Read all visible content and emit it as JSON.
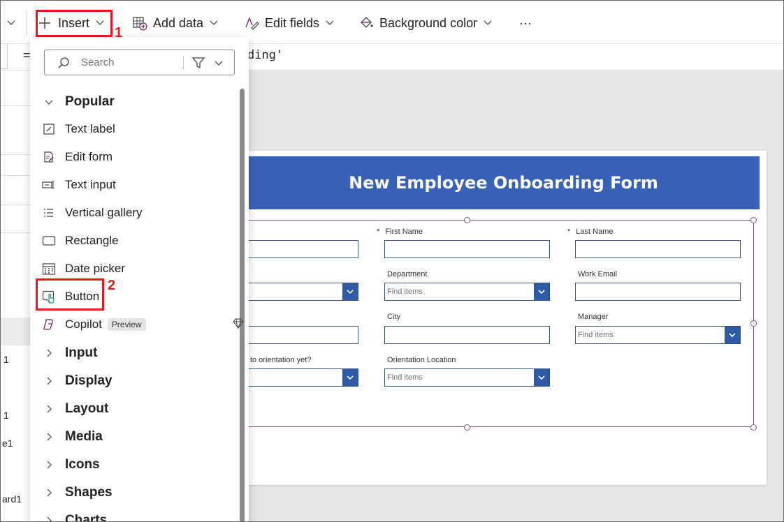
{
  "toolbar": {
    "insert_label": "Insert",
    "add_data_label": "Add data",
    "edit_fields_label": "Edit fields",
    "background_color_label": "Background color",
    "more_label": "···"
  },
  "callouts": {
    "step1": "1",
    "step2": "2"
  },
  "formula": {
    "equals": "=",
    "text": "ding'"
  },
  "tree": {
    "item_a": "1",
    "item_b": "1",
    "item_c": "e1",
    "item_d": "ard1"
  },
  "insert_panel": {
    "search_placeholder": "Search",
    "popular_label": "Popular",
    "items": [
      {
        "label": "Text label",
        "icon": "text-label-icon"
      },
      {
        "label": "Edit form",
        "icon": "edit-form-icon"
      },
      {
        "label": "Text input",
        "icon": "text-input-icon"
      },
      {
        "label": "Vertical gallery",
        "icon": "vertical-gallery-icon"
      },
      {
        "label": "Rectangle",
        "icon": "rectangle-icon"
      },
      {
        "label": "Date picker",
        "icon": "date-picker-icon"
      },
      {
        "label": "Button",
        "icon": "button-icon"
      },
      {
        "label": "Copilot",
        "icon": "copilot-icon",
        "badge": "Preview"
      }
    ],
    "categories": [
      "Input",
      "Display",
      "Layout",
      "Media",
      "Icons",
      "Shapes",
      "Charts"
    ]
  },
  "form": {
    "title": "New Employee Onboarding Form",
    "required_marker": "*",
    "first_name_label": "First Name",
    "last_name_label": "Last Name",
    "department_label": "Department",
    "work_email_label": "Work Email",
    "city_label": "City",
    "manager_label": "Manager",
    "orientation_question_partial": "to orientation yet?",
    "orientation_location_label": "Orientation Location",
    "find_items_placeholder": "Find items"
  },
  "colors": {
    "header_blue": "#3a61b8",
    "dropdown_button_blue": "#2f5aa8",
    "callout_red": "#e8191a",
    "selection_purple": "#8a4e8a"
  }
}
